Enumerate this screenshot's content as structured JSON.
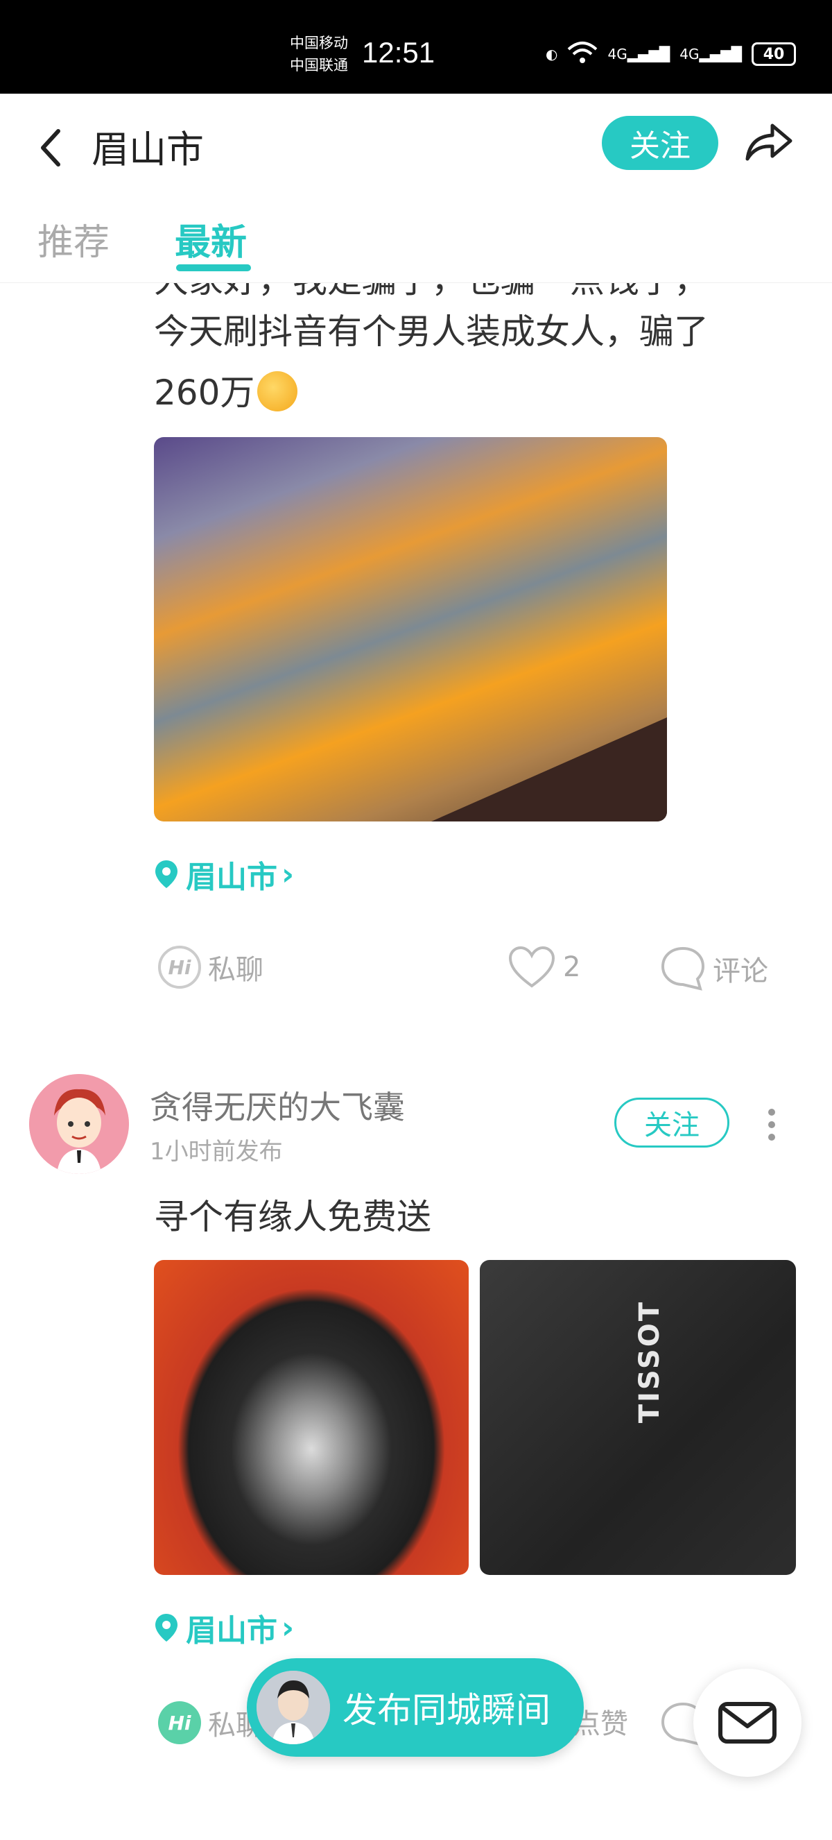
{
  "status_bar": {
    "carrier1": "中国移动",
    "carrier2": "中国联通",
    "time": "12:51",
    "network1": "4G",
    "network2": "4G",
    "battery": "40"
  },
  "header": {
    "title": "眉山市",
    "follow_label": "关注"
  },
  "tabs": [
    {
      "label": "推荐",
      "active": false
    },
    {
      "label": "最新",
      "active": true
    }
  ],
  "post1": {
    "text_partial": "大家好，我是骗子，也骗一点钱了，",
    "text_line2": "今天刷抖音有个男人装成女人，骗了",
    "text_line3": "260万",
    "location": "眉山市",
    "actions": {
      "chat": "私聊",
      "likes": "2",
      "comment": "评论"
    }
  },
  "post2": {
    "username": "贪得无厌的大飞囊",
    "time": "1小时前发布",
    "follow_label": "关注",
    "text": "寻个有缘人免费送",
    "image2_brand": "TISSOT",
    "location": "眉山市",
    "actions": {
      "chat": "私聊",
      "like": "点赞"
    }
  },
  "publish_button": {
    "label": "发布同城瞬间"
  },
  "colors": {
    "accent": "#27c9c3"
  }
}
